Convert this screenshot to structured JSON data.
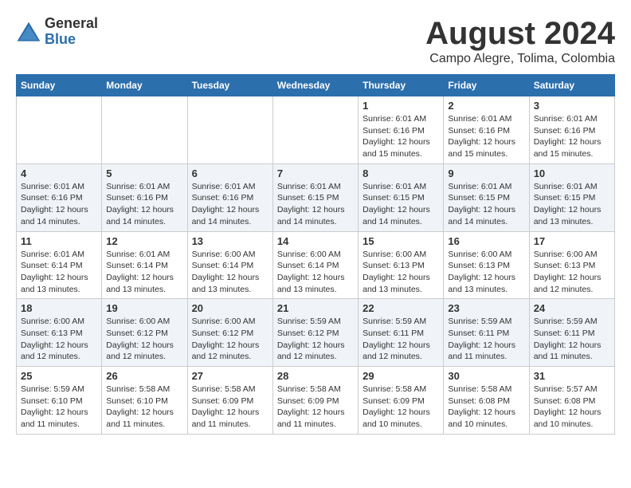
{
  "logo": {
    "general": "General",
    "blue": "Blue"
  },
  "title": {
    "month_year": "August 2024",
    "location": "Campo Alegre, Tolima, Colombia"
  },
  "headers": [
    "Sunday",
    "Monday",
    "Tuesday",
    "Wednesday",
    "Thursday",
    "Friday",
    "Saturday"
  ],
  "weeks": [
    [
      {
        "day": "",
        "info": ""
      },
      {
        "day": "",
        "info": ""
      },
      {
        "day": "",
        "info": ""
      },
      {
        "day": "",
        "info": ""
      },
      {
        "day": "1",
        "info": "Sunrise: 6:01 AM\nSunset: 6:16 PM\nDaylight: 12 hours\nand 15 minutes."
      },
      {
        "day": "2",
        "info": "Sunrise: 6:01 AM\nSunset: 6:16 PM\nDaylight: 12 hours\nand 15 minutes."
      },
      {
        "day": "3",
        "info": "Sunrise: 6:01 AM\nSunset: 6:16 PM\nDaylight: 12 hours\nand 15 minutes."
      }
    ],
    [
      {
        "day": "4",
        "info": "Sunrise: 6:01 AM\nSunset: 6:16 PM\nDaylight: 12 hours\nand 14 minutes."
      },
      {
        "day": "5",
        "info": "Sunrise: 6:01 AM\nSunset: 6:16 PM\nDaylight: 12 hours\nand 14 minutes."
      },
      {
        "day": "6",
        "info": "Sunrise: 6:01 AM\nSunset: 6:16 PM\nDaylight: 12 hours\nand 14 minutes."
      },
      {
        "day": "7",
        "info": "Sunrise: 6:01 AM\nSunset: 6:15 PM\nDaylight: 12 hours\nand 14 minutes."
      },
      {
        "day": "8",
        "info": "Sunrise: 6:01 AM\nSunset: 6:15 PM\nDaylight: 12 hours\nand 14 minutes."
      },
      {
        "day": "9",
        "info": "Sunrise: 6:01 AM\nSunset: 6:15 PM\nDaylight: 12 hours\nand 14 minutes."
      },
      {
        "day": "10",
        "info": "Sunrise: 6:01 AM\nSunset: 6:15 PM\nDaylight: 12 hours\nand 13 minutes."
      }
    ],
    [
      {
        "day": "11",
        "info": "Sunrise: 6:01 AM\nSunset: 6:14 PM\nDaylight: 12 hours\nand 13 minutes."
      },
      {
        "day": "12",
        "info": "Sunrise: 6:01 AM\nSunset: 6:14 PM\nDaylight: 12 hours\nand 13 minutes."
      },
      {
        "day": "13",
        "info": "Sunrise: 6:00 AM\nSunset: 6:14 PM\nDaylight: 12 hours\nand 13 minutes."
      },
      {
        "day": "14",
        "info": "Sunrise: 6:00 AM\nSunset: 6:14 PM\nDaylight: 12 hours\nand 13 minutes."
      },
      {
        "day": "15",
        "info": "Sunrise: 6:00 AM\nSunset: 6:13 PM\nDaylight: 12 hours\nand 13 minutes."
      },
      {
        "day": "16",
        "info": "Sunrise: 6:00 AM\nSunset: 6:13 PM\nDaylight: 12 hours\nand 13 minutes."
      },
      {
        "day": "17",
        "info": "Sunrise: 6:00 AM\nSunset: 6:13 PM\nDaylight: 12 hours\nand 12 minutes."
      }
    ],
    [
      {
        "day": "18",
        "info": "Sunrise: 6:00 AM\nSunset: 6:13 PM\nDaylight: 12 hours\nand 12 minutes."
      },
      {
        "day": "19",
        "info": "Sunrise: 6:00 AM\nSunset: 6:12 PM\nDaylight: 12 hours\nand 12 minutes."
      },
      {
        "day": "20",
        "info": "Sunrise: 6:00 AM\nSunset: 6:12 PM\nDaylight: 12 hours\nand 12 minutes."
      },
      {
        "day": "21",
        "info": "Sunrise: 5:59 AM\nSunset: 6:12 PM\nDaylight: 12 hours\nand 12 minutes."
      },
      {
        "day": "22",
        "info": "Sunrise: 5:59 AM\nSunset: 6:11 PM\nDaylight: 12 hours\nand 12 minutes."
      },
      {
        "day": "23",
        "info": "Sunrise: 5:59 AM\nSunset: 6:11 PM\nDaylight: 12 hours\nand 11 minutes."
      },
      {
        "day": "24",
        "info": "Sunrise: 5:59 AM\nSunset: 6:11 PM\nDaylight: 12 hours\nand 11 minutes."
      }
    ],
    [
      {
        "day": "25",
        "info": "Sunrise: 5:59 AM\nSunset: 6:10 PM\nDaylight: 12 hours\nand 11 minutes."
      },
      {
        "day": "26",
        "info": "Sunrise: 5:58 AM\nSunset: 6:10 PM\nDaylight: 12 hours\nand 11 minutes."
      },
      {
        "day": "27",
        "info": "Sunrise: 5:58 AM\nSunset: 6:09 PM\nDaylight: 12 hours\nand 11 minutes."
      },
      {
        "day": "28",
        "info": "Sunrise: 5:58 AM\nSunset: 6:09 PM\nDaylight: 12 hours\nand 11 minutes."
      },
      {
        "day": "29",
        "info": "Sunrise: 5:58 AM\nSunset: 6:09 PM\nDaylight: 12 hours\nand 10 minutes."
      },
      {
        "day": "30",
        "info": "Sunrise: 5:58 AM\nSunset: 6:08 PM\nDaylight: 12 hours\nand 10 minutes."
      },
      {
        "day": "31",
        "info": "Sunrise: 5:57 AM\nSunset: 6:08 PM\nDaylight: 12 hours\nand 10 minutes."
      }
    ]
  ]
}
